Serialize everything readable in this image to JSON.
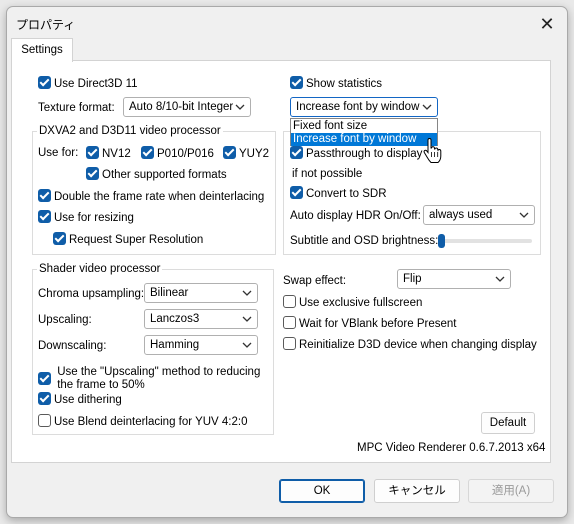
{
  "window": {
    "title": "プロパティ"
  },
  "tabs": [
    {
      "label": "Settings"
    }
  ],
  "left": {
    "use_d3d11": {
      "label": "Use Direct3D 11",
      "checked": true
    },
    "texture_format": {
      "label": "Texture format:",
      "value": "Auto 8/10-bit Integer"
    },
    "dxva_group": {
      "title": "DXVA2 and D3D11 video processor",
      "use_for_label": "Use for:",
      "nv12": {
        "label": "NV12",
        "checked": true
      },
      "p010": {
        "label": "P010/P016",
        "checked": true
      },
      "yuy2": {
        "label": "YUY2",
        "checked": true
      },
      "other_formats": {
        "label": "Other supported formats",
        "checked": true
      },
      "double_frame_rate": {
        "label": "Double the frame rate when deinterlacing",
        "checked": true
      },
      "use_resizing": {
        "label": "Use for resizing",
        "checked": true
      },
      "super_resolution": {
        "label": "Request Super Resolution",
        "checked": true
      }
    },
    "shader_group": {
      "title": "Shader video processor",
      "chroma": {
        "label": "Chroma upsampling:",
        "value": "Bilinear"
      },
      "upscaling": {
        "label": "Upscaling:",
        "value": "Lanczos3"
      },
      "downscaling": {
        "label": "Downscaling:",
        "value": "Hamming"
      },
      "upscaling_method": {
        "label_line1": "Use the \"Upscaling\" method to reducing",
        "label_line2": "the frame to 50%",
        "checked": true
      },
      "dithering": {
        "label": "Use dithering",
        "checked": true
      },
      "blend_deint": {
        "label": "Use Blend deinterlacing for YUV 4:2:0",
        "checked": false
      }
    }
  },
  "right": {
    "show_statistics": {
      "label": "Show statistics",
      "checked": true
    },
    "font_combo": {
      "value": "Increase font by window",
      "options": [
        "Fixed font size",
        "Increase font by window"
      ],
      "selected_option": "Increase font by window"
    },
    "hdr_group": {
      "passthrough": {
        "label": "Passthrough to display",
        "checked": true
      },
      "not_possible": "if not possible",
      "convert_sdr": {
        "label": "Convert to SDR",
        "checked": true
      },
      "auto_hdr": {
        "label": "Auto display HDR On/Off:",
        "value": "always used"
      },
      "brightness": {
        "label": "Subtitle and OSD brightness:",
        "level_fraction": 0.0
      }
    },
    "swap_effect": {
      "label": "Swap effect:",
      "value": "Flip"
    },
    "exclusive_fullscreen": {
      "label": "Use exclusive fullscreen",
      "checked": false
    },
    "wait_vblank": {
      "label": "Wait for VBlank before Present",
      "checked": false
    },
    "reinit_d3d": {
      "label": "Reinitialize D3D device when changing display",
      "checked": false
    },
    "default_button": "Default",
    "version": "MPC Video Renderer 0.6.7.2013 x64"
  },
  "buttons": {
    "ok": "OK",
    "cancel": "キャンセル",
    "apply": "適用(A)"
  },
  "icons": {
    "close": "close-icon",
    "checkbox": "checkbox-icon",
    "dropdown": "chevron-down-icon",
    "cursor": "hand-pointer-icon"
  },
  "colors": {
    "accent": "#0f5da8",
    "selection": "#0078d7"
  }
}
